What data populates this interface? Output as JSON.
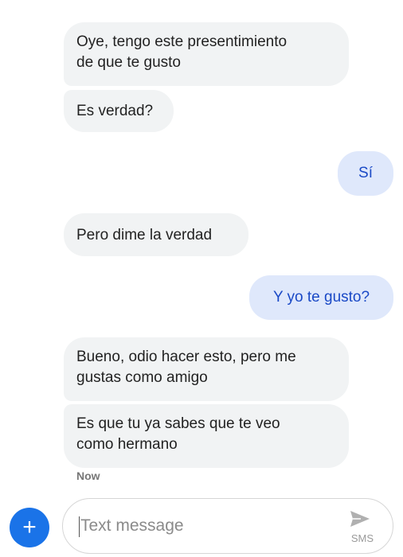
{
  "messages": [
    {
      "side": "incoming",
      "text": "Oye, tengo este presentimiento\nde que te gusto"
    },
    {
      "side": "incoming",
      "text": "Es verdad?"
    },
    {
      "side": "outgoing",
      "text": "Sí"
    },
    {
      "side": "incoming",
      "text": "Pero dime la verdad"
    },
    {
      "side": "outgoing",
      "text": "Y yo te gusto?"
    },
    {
      "side": "incoming",
      "text": "Bueno, odio hacer esto, pero me\ngustas como amigo"
    },
    {
      "side": "incoming",
      "text": "Es que tu ya sabes que te veo\ncomo hermano"
    }
  ],
  "timestamp": "Now",
  "composer": {
    "placeholder": "Text message",
    "send_label": "SMS",
    "add_symbol": "+"
  },
  "colors": {
    "incoming_bubble": "#f1f3f4",
    "outgoing_bubble": "#dfe8fb",
    "outgoing_text": "#1a49c6",
    "accent": "#1a73e8"
  },
  "icons": {
    "add": "plus-icon",
    "send": "send-icon"
  }
}
